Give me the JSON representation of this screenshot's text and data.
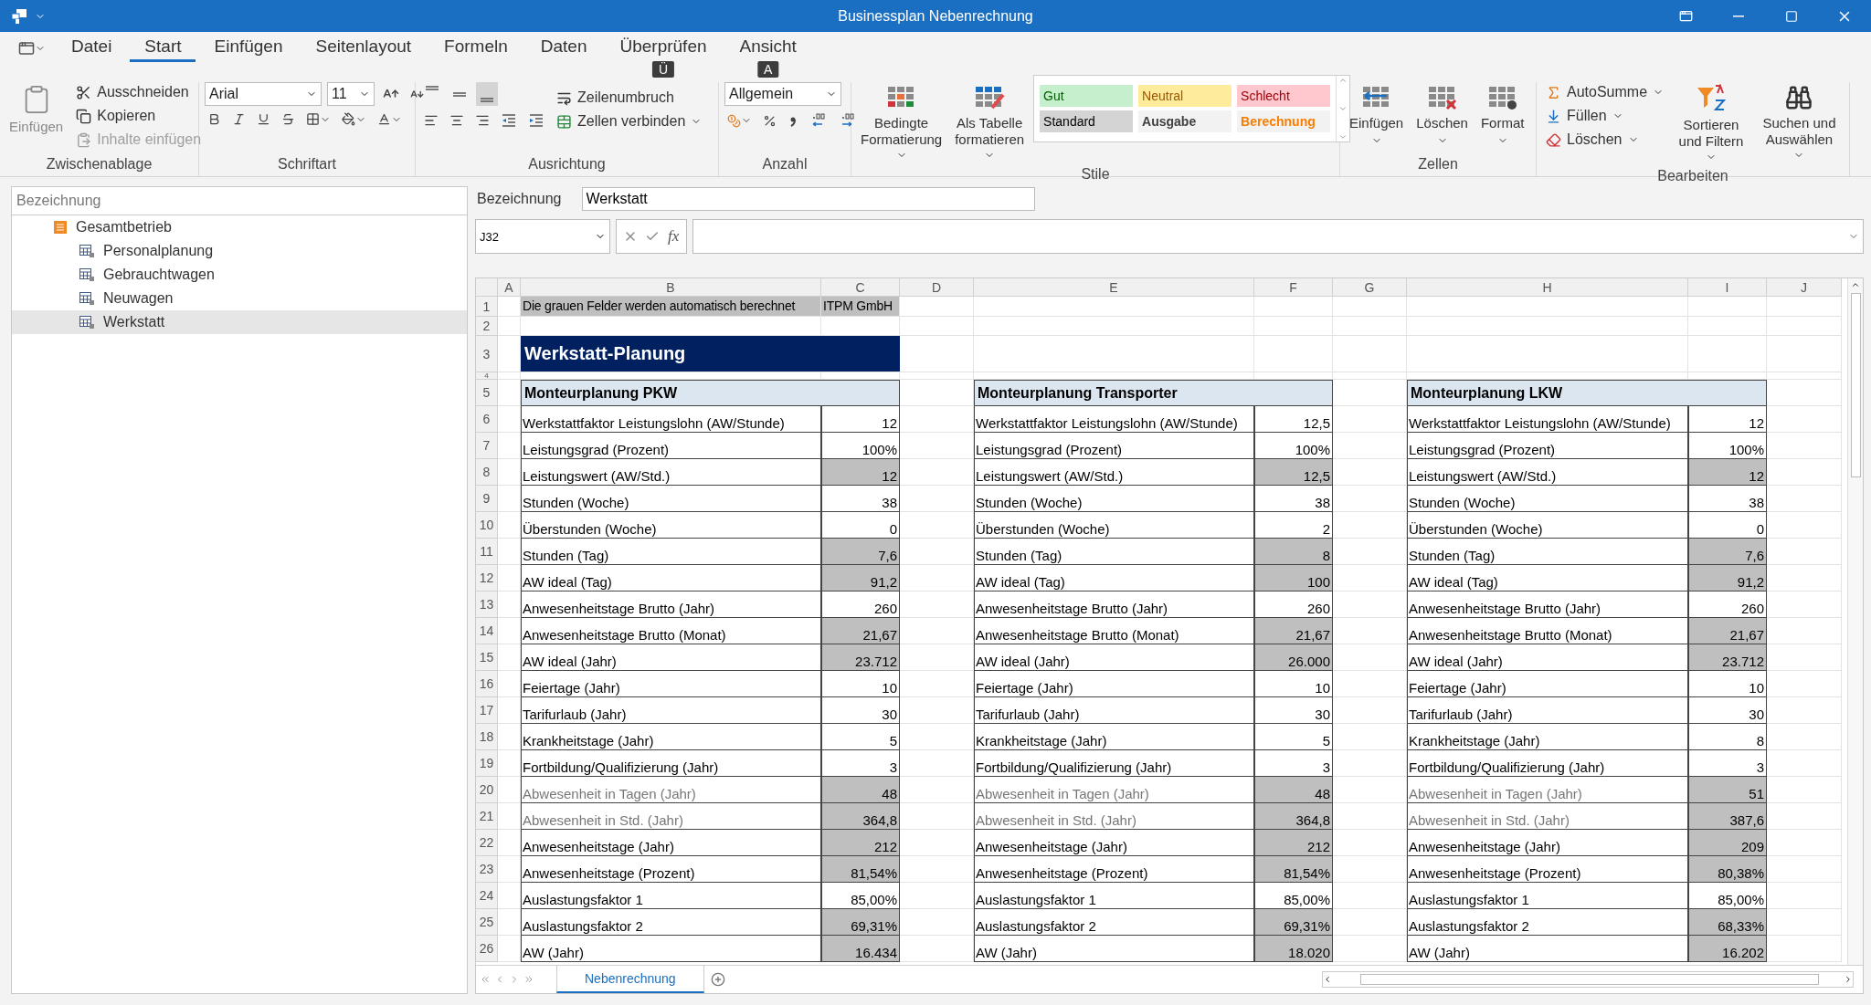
{
  "window": {
    "title": "Businessplan Nebenrechnung"
  },
  "ribbon_tabs": [
    {
      "label": "Datei",
      "selected": false
    },
    {
      "label": "Start",
      "selected": true
    },
    {
      "label": "Einfügen",
      "selected": false
    },
    {
      "label": "Seitenlayout",
      "selected": false
    },
    {
      "label": "Formeln",
      "selected": false
    },
    {
      "label": "Daten",
      "selected": false
    },
    {
      "label": "Überprüfen",
      "selected": false,
      "keytip": "Ü"
    },
    {
      "label": "Ansicht",
      "selected": false,
      "keytip": "A"
    }
  ],
  "clipboard": {
    "label": "Zwischenablage",
    "paste": {
      "label": "Einfügen",
      "disabled": true
    },
    "items": [
      {
        "label": "Ausschneiden",
        "kind": "cut",
        "disabled": false
      },
      {
        "label": "Kopieren",
        "kind": "copy",
        "disabled": false
      },
      {
        "label": "Inhalte einfügen",
        "kind": "paste-special",
        "disabled": true
      }
    ]
  },
  "font": {
    "label": "Schriftart",
    "family": "Arial",
    "size": "11"
  },
  "alignment": {
    "label": "Ausrichtung",
    "wrap": "Zeilenumbruch",
    "merge": "Zellen verbinden",
    "vertical_align": [
      {
        "kind": "top",
        "selected": false
      },
      {
        "kind": "middle",
        "selected": false
      },
      {
        "kind": "bottom",
        "selected": true
      }
    ]
  },
  "number": {
    "label": "Anzahl",
    "format": "Allgemein"
  },
  "styles": {
    "label": "Stile",
    "conditional": "Bedingte Formatierung",
    "as_table": "Als Tabelle formatieren",
    "gallery": [
      {
        "label": "Gut",
        "kind": "good",
        "selected": false
      },
      {
        "label": "Neutral",
        "kind": "neutral",
        "selected": false
      },
      {
        "label": "Schlecht",
        "kind": "bad",
        "selected": false
      },
      {
        "label": "Standard",
        "kind": "normal",
        "selected": true
      },
      {
        "label": "Ausgabe",
        "kind": "output",
        "selected": false
      },
      {
        "label": "Berechnung",
        "kind": "calculation",
        "selected": false
      }
    ]
  },
  "cells": {
    "label": "Zellen",
    "buttons": [
      {
        "label": "Einfügen",
        "kind": "insert"
      },
      {
        "label": "Löschen",
        "kind": "delete"
      },
      {
        "label": "Format",
        "kind": "format"
      }
    ]
  },
  "editing": {
    "label": "Bearbeiten",
    "items": [
      {
        "label": "AutoSumme",
        "kind": "sum"
      },
      {
        "label": "Füllen",
        "kind": "fill"
      },
      {
        "label": "Löschen",
        "kind": "clear"
      }
    ],
    "sort": "Sortieren und Filtern",
    "find": "Suchen und Auswählen"
  },
  "navigator": {
    "header": "Bezeichnung",
    "tree": [
      {
        "label": "Gesamtbetrieb",
        "selected": false,
        "children": [
          {
            "label": "Personalplanung",
            "selected": false
          },
          {
            "label": "Gebrauchtwagen",
            "selected": false
          },
          {
            "label": "Neuwagen",
            "selected": false
          },
          {
            "label": "Werkstatt",
            "selected": true
          }
        ]
      }
    ]
  },
  "formula_bar": {
    "name_label": "Bezeichnung",
    "name_value": "Werkstatt",
    "cell_ref": "J32",
    "fx": "fx"
  },
  "sheet": {
    "columns": [
      "A",
      "B",
      "C",
      "D",
      "E",
      "F",
      "G",
      "H",
      "I",
      "J"
    ],
    "rows": [
      "1",
      "2",
      "3",
      "4",
      "5",
      "6",
      "7",
      "8",
      "9",
      "10",
      "11",
      "12",
      "13",
      "14",
      "15",
      "16",
      "17",
      "18",
      "19",
      "20",
      "21",
      "22",
      "23",
      "24",
      "25",
      "26"
    ],
    "note": "Die grauen Felder werden automatisch berechnet",
    "company": "ITPM GmbH",
    "title": "Werkstatt-Planung",
    "tables": [
      {
        "title": "Monteurplanung PKW",
        "rows": [
          {
            "label": "Werkstattfaktor Leistungslohn (AW/Stunde)",
            "value": "12",
            "calculated": false,
            "dimmed": false
          },
          {
            "label": "Leistungsgrad (Prozent)",
            "value": "100%",
            "calculated": false,
            "dimmed": false
          },
          {
            "label": "Leistungswert (AW/Std.)",
            "value": "12",
            "calculated": true,
            "dimmed": false
          },
          {
            "label": "Stunden (Woche)",
            "value": "38",
            "calculated": false,
            "dimmed": false
          },
          {
            "label": "Überstunden (Woche)",
            "value": "0",
            "calculated": false,
            "dimmed": false
          },
          {
            "label": "Stunden (Tag)",
            "value": "7,6",
            "calculated": true,
            "dimmed": false
          },
          {
            "label": "AW ideal (Tag)",
            "value": "91,2",
            "calculated": true,
            "dimmed": false
          },
          {
            "label": "Anwesenheitstage Brutto (Jahr)",
            "value": "260",
            "calculated": false,
            "dimmed": false
          },
          {
            "label": "Anwesenheitstage Brutto (Monat)",
            "value": "21,67",
            "calculated": true,
            "dimmed": false
          },
          {
            "label": "AW ideal (Jahr)",
            "value": "23.712",
            "calculated": true,
            "dimmed": false
          },
          {
            "label": "Feiertage (Jahr)",
            "value": "10",
            "calculated": false,
            "dimmed": false
          },
          {
            "label": "Tarifurlaub (Jahr)",
            "value": "30",
            "calculated": false,
            "dimmed": false
          },
          {
            "label": "Krankheitstage (Jahr)",
            "value": "5",
            "calculated": false,
            "dimmed": false
          },
          {
            "label": "Fortbildung/Qualifizierung (Jahr)",
            "value": "3",
            "calculated": false,
            "dimmed": false
          },
          {
            "label": "Abwesenheit in Tagen (Jahr)",
            "value": "48",
            "calculated": true,
            "dimmed": true
          },
          {
            "label": "Abwesenheit in Std. (Jahr)",
            "value": "364,8",
            "calculated": true,
            "dimmed": true
          },
          {
            "label": "Anwesenheitstage (Jahr)",
            "value": "212",
            "calculated": true,
            "dimmed": false
          },
          {
            "label": "Anwesenheitstage (Prozent)",
            "value": "81,54%",
            "calculated": true,
            "dimmed": false
          },
          {
            "label": "Auslastungsfaktor 1",
            "value": "85,00%",
            "calculated": false,
            "dimmed": false
          },
          {
            "label": "Auslastungsfaktor 2",
            "value": "69,31%",
            "calculated": true,
            "dimmed": false
          },
          {
            "label": "AW (Jahr)",
            "value": "16.434",
            "calculated": true,
            "dimmed": false
          }
        ]
      },
      {
        "title": "Monteurplanung Transporter",
        "rows": [
          {
            "label": "Werkstattfaktor Leistungslohn (AW/Stunde)",
            "value": "12,5",
            "calculated": false,
            "dimmed": false
          },
          {
            "label": "Leistungsgrad (Prozent)",
            "value": "100%",
            "calculated": false,
            "dimmed": false
          },
          {
            "label": "Leistungswert (AW/Std.)",
            "value": "12,5",
            "calculated": true,
            "dimmed": false
          },
          {
            "label": "Stunden (Woche)",
            "value": "38",
            "calculated": false,
            "dimmed": false
          },
          {
            "label": "Überstunden (Woche)",
            "value": "2",
            "calculated": false,
            "dimmed": false
          },
          {
            "label": "Stunden (Tag)",
            "value": "8",
            "calculated": true,
            "dimmed": false
          },
          {
            "label": "AW ideal (Tag)",
            "value": "100",
            "calculated": true,
            "dimmed": false
          },
          {
            "label": "Anwesenheitstage Brutto (Jahr)",
            "value": "260",
            "calculated": false,
            "dimmed": false
          },
          {
            "label": "Anwesenheitstage Brutto (Monat)",
            "value": "21,67",
            "calculated": true,
            "dimmed": false
          },
          {
            "label": "AW ideal (Jahr)",
            "value": "26.000",
            "calculated": true,
            "dimmed": false
          },
          {
            "label": "Feiertage (Jahr)",
            "value": "10",
            "calculated": false,
            "dimmed": false
          },
          {
            "label": "Tarifurlaub (Jahr)",
            "value": "30",
            "calculated": false,
            "dimmed": false
          },
          {
            "label": "Krankheitstage (Jahr)",
            "value": "5",
            "calculated": false,
            "dimmed": false
          },
          {
            "label": "Fortbildung/Qualifizierung (Jahr)",
            "value": "3",
            "calculated": false,
            "dimmed": false
          },
          {
            "label": "Abwesenheit in Tagen (Jahr)",
            "value": "48",
            "calculated": true,
            "dimmed": true
          },
          {
            "label": "Abwesenheit in Std. (Jahr)",
            "value": "364,8",
            "calculated": true,
            "dimmed": true
          },
          {
            "label": "Anwesenheitstage (Jahr)",
            "value": "212",
            "calculated": true,
            "dimmed": false
          },
          {
            "label": "Anwesenheitstage (Prozent)",
            "value": "81,54%",
            "calculated": true,
            "dimmed": false
          },
          {
            "label": "Auslastungsfaktor 1",
            "value": "85,00%",
            "calculated": false,
            "dimmed": false
          },
          {
            "label": "Auslastungsfaktor 2",
            "value": "69,31%",
            "calculated": true,
            "dimmed": false
          },
          {
            "label": "AW (Jahr)",
            "value": "18.020",
            "calculated": true,
            "dimmed": false
          }
        ]
      },
      {
        "title": "Monteurplanung LKW",
        "rows": [
          {
            "label": "Werkstattfaktor Leistungslohn (AW/Stunde)",
            "value": "12",
            "calculated": false,
            "dimmed": false
          },
          {
            "label": "Leistungsgrad (Prozent)",
            "value": "100%",
            "calculated": false,
            "dimmed": false
          },
          {
            "label": "Leistungswert (AW/Std.)",
            "value": "12",
            "calculated": true,
            "dimmed": false
          },
          {
            "label": "Stunden (Woche)",
            "value": "38",
            "calculated": false,
            "dimmed": false
          },
          {
            "label": "Überstunden (Woche)",
            "value": "0",
            "calculated": false,
            "dimmed": false
          },
          {
            "label": "Stunden (Tag)",
            "value": "7,6",
            "calculated": true,
            "dimmed": false
          },
          {
            "label": "AW ideal (Tag)",
            "value": "91,2",
            "calculated": true,
            "dimmed": false
          },
          {
            "label": "Anwesenheitstage Brutto (Jahr)",
            "value": "260",
            "calculated": false,
            "dimmed": false
          },
          {
            "label": "Anwesenheitstage Brutto (Monat)",
            "value": "21,67",
            "calculated": true,
            "dimmed": false
          },
          {
            "label": "AW ideal (Jahr)",
            "value": "23.712",
            "calculated": true,
            "dimmed": false
          },
          {
            "label": "Feiertage (Jahr)",
            "value": "10",
            "calculated": false,
            "dimmed": false
          },
          {
            "label": "Tarifurlaub (Jahr)",
            "value": "30",
            "calculated": false,
            "dimmed": false
          },
          {
            "label": "Krankheitstage (Jahr)",
            "value": "8",
            "calculated": false,
            "dimmed": false
          },
          {
            "label": "Fortbildung/Qualifizierung (Jahr)",
            "value": "3",
            "calculated": false,
            "dimmed": false
          },
          {
            "label": "Abwesenheit in Tagen (Jahr)",
            "value": "51",
            "calculated": true,
            "dimmed": true
          },
          {
            "label": "Abwesenheit in Std. (Jahr)",
            "value": "387,6",
            "calculated": true,
            "dimmed": true
          },
          {
            "label": "Anwesenheitstage (Jahr)",
            "value": "209",
            "calculated": true,
            "dimmed": false
          },
          {
            "label": "Anwesenheitstage (Prozent)",
            "value": "80,38%",
            "calculated": true,
            "dimmed": false
          },
          {
            "label": "Auslastungsfaktor 1",
            "value": "85,00%",
            "calculated": false,
            "dimmed": false
          },
          {
            "label": "Auslastungsfaktor 2",
            "value": "68,33%",
            "calculated": true,
            "dimmed": false
          },
          {
            "label": "AW (Jahr)",
            "value": "16.202",
            "calculated": true,
            "dimmed": false
          }
        ]
      }
    ]
  },
  "sheet_tabs": [
    {
      "label": "Nebenrechnung",
      "selected": true
    }
  ]
}
